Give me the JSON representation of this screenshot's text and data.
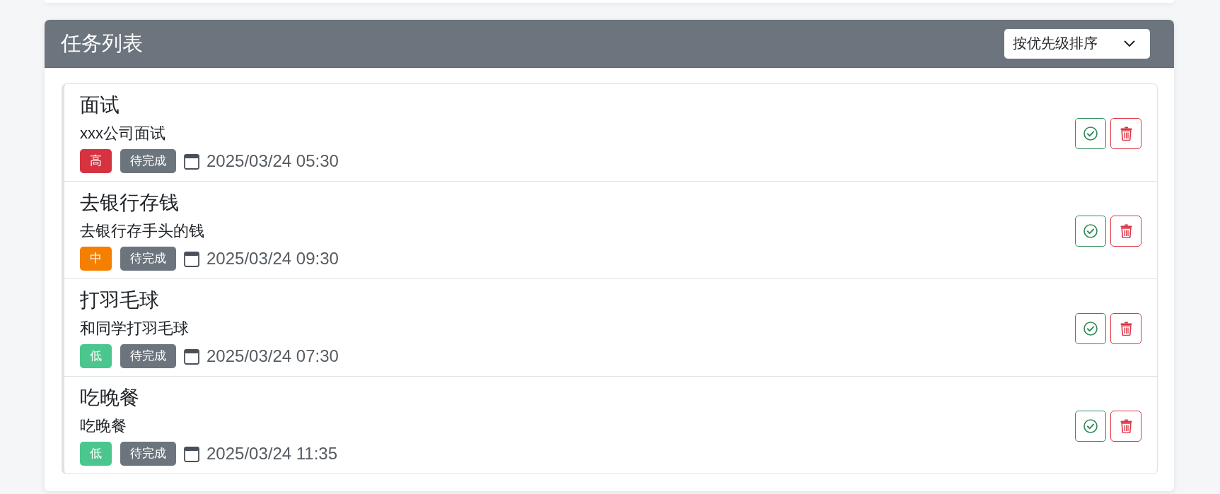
{
  "card": {
    "title": "任务列表",
    "sort_select": {
      "value": "按优先级排序"
    }
  },
  "tasks": [
    {
      "title": "面试",
      "description": "xxx公司面试",
      "priority": {
        "label": "高",
        "color": "#d63341"
      },
      "status": "待完成",
      "due": "2025/03/24 05:30"
    },
    {
      "title": "去银行存钱",
      "description": "去银行存手头的钱",
      "priority": {
        "label": "中",
        "color": "#f57f00"
      },
      "status": "待完成",
      "due": "2025/03/24 09:30"
    },
    {
      "title": "打羽毛球",
      "description": "和同学打羽毛球",
      "priority": {
        "label": "低",
        "color": "#4bc68e"
      },
      "status": "待完成",
      "due": "2025/03/24 07:30"
    },
    {
      "title": "吃晚餐",
      "description": "吃晚餐",
      "priority": {
        "label": "低",
        "color": "#4bc68e"
      },
      "status": "待完成",
      "due": "2025/03/24 11:35"
    }
  ]
}
